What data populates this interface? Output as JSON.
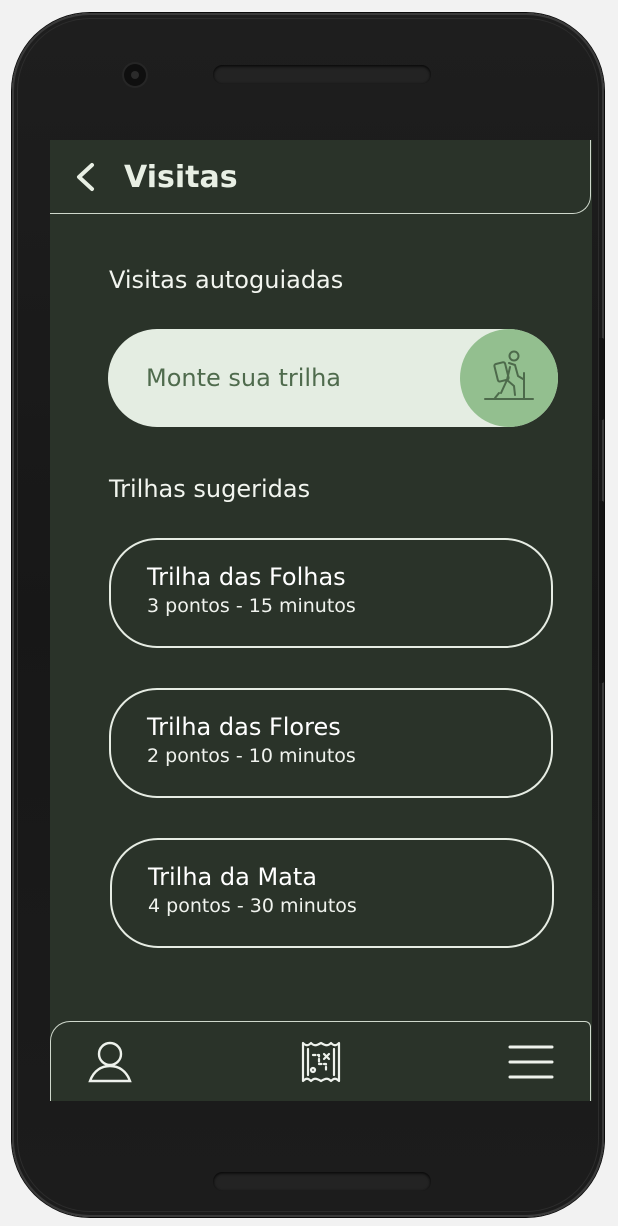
{
  "header": {
    "title": "Visitas",
    "back_icon": "chevron-left-icon"
  },
  "sections": {
    "self_guided_title": "Visitas autoguiadas",
    "suggested_title": "Trilhas sugeridas"
  },
  "create_trail": {
    "label": "Monte sua trilha",
    "icon": "hiker-icon",
    "accent_color": "#93bf8f",
    "background_color": "#e4ede2"
  },
  "trails": [
    {
      "name": "Trilha das Folhas",
      "meta": "3 pontos - 15 minutos"
    },
    {
      "name": "Trilha das Flores",
      "meta": "2 pontos - 10 minutos"
    },
    {
      "name": "Trilha da Mata",
      "meta": "4 pontos - 30 minutos"
    }
  ],
  "bottom_nav": {
    "items": [
      {
        "icon": "user-icon"
      },
      {
        "icon": "map-icon"
      },
      {
        "icon": "hamburger-menu-icon"
      }
    ]
  },
  "theme": {
    "screen_background": "#2a3329",
    "text_color": "#f2f5ef"
  }
}
